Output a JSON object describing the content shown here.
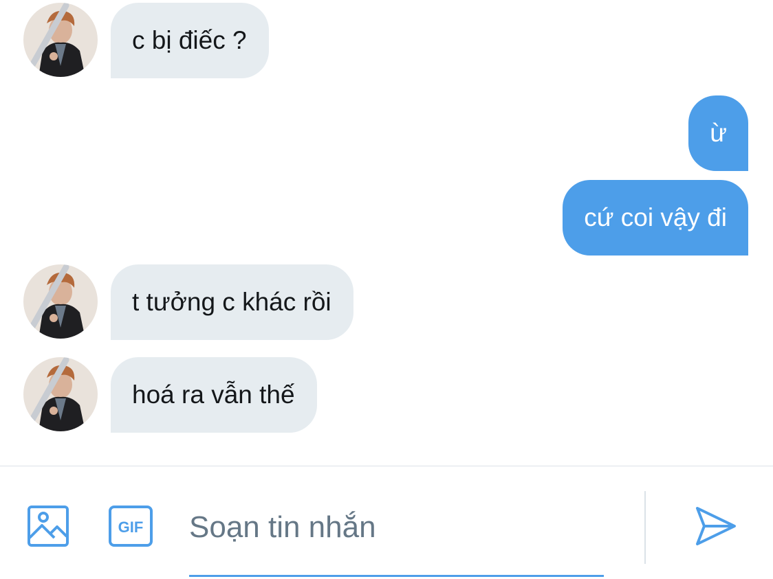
{
  "conversation": {
    "messages": [
      {
        "direction": "incoming",
        "text": "c bị điếc ?"
      },
      {
        "direction": "outgoing",
        "text": "ừ"
      },
      {
        "direction": "outgoing",
        "text": "cứ coi vậy đi"
      },
      {
        "direction": "incoming",
        "text": "t tưởng c khác rồi"
      },
      {
        "direction": "incoming",
        "text": "hoá ra vẫn thế"
      }
    ]
  },
  "composer": {
    "image_icon": "image-icon",
    "gif_icon": "gif-icon",
    "gif_label": "GIF",
    "placeholder": "Soạn tin nhắn",
    "value": "",
    "send_icon": "send-icon"
  },
  "colors": {
    "incoming_bubble": "#e6ecf0",
    "outgoing_bubble": "#4d9ee9",
    "accent": "#4d9ee9",
    "text_dark": "#14171a",
    "placeholder": "#657786"
  }
}
